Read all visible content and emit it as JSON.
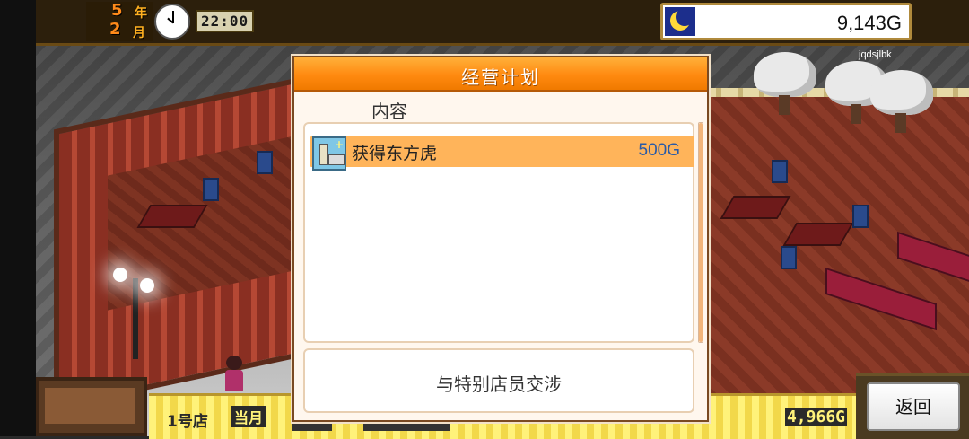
{
  "date": {
    "year_num": "5",
    "year_unit": "年",
    "month_num": "2",
    "month_unit": "月"
  },
  "time": "22:00",
  "money": "9,143G",
  "user_tag": "jqdsjlbk",
  "dialog": {
    "title": "经营计划",
    "content_label": "内容",
    "items": [
      {
        "name": "获得东方虎",
        "cost": "500G",
        "icon": "plan-item-icon"
      }
    ],
    "action_label": "与特别店员交涉"
  },
  "bottom": {
    "shop_label": "1号店",
    "month_label": "当月",
    "total": "4,966G"
  },
  "back_label": "返回",
  "colors": {
    "header_orange": "#ff8a10",
    "row_highlight": "#ffb45a",
    "cost_blue": "#2a5aa6",
    "bar_yellow": "#fff27a"
  }
}
